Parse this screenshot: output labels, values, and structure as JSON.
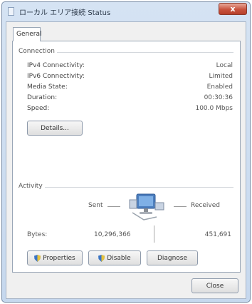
{
  "window": {
    "title": "ローカル エリア接続 Status",
    "close_glyph": "x"
  },
  "tabs": [
    {
      "label": "General"
    }
  ],
  "connection": {
    "group_label": "Connection",
    "rows": [
      {
        "label": "IPv4 Connectivity:",
        "value": "Local"
      },
      {
        "label": "IPv6 Connectivity:",
        "value": "Limited"
      },
      {
        "label": "Media State:",
        "value": "Enabled"
      },
      {
        "label": "Duration:",
        "value": "00:30:36"
      },
      {
        "label": "Speed:",
        "value": "100.0 Mbps"
      }
    ],
    "details_button": "Details..."
  },
  "activity": {
    "group_label": "Activity",
    "sent_label": "Sent",
    "received_label": "Received",
    "bytes_label": "Bytes:",
    "bytes_sent": "10,296,366",
    "bytes_received": "451,691"
  },
  "buttons": {
    "properties": "Properties",
    "disable": "Disable",
    "diagnose": "Diagnose",
    "close": "Close"
  },
  "icons": {
    "window": "network-icon",
    "shield": "uac-shield-icon",
    "network": "network-computer-icon"
  },
  "colors": {
    "titlebar": "#c6d8ee",
    "close_button": "#c8533e",
    "panel": "#ffffff",
    "frame": "#f0f0f0"
  }
}
